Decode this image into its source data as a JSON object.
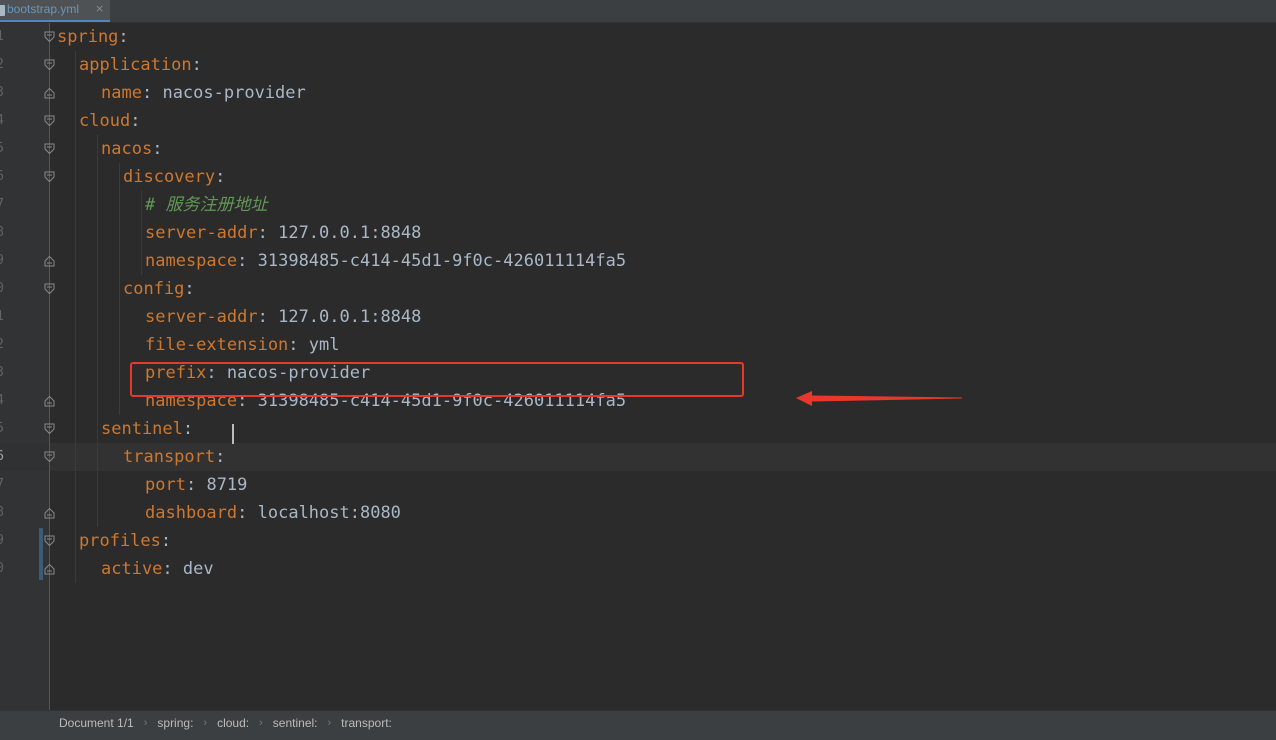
{
  "tab": {
    "filename": "bootstrap.yml",
    "close_glyph": "×",
    "icon": "yaml-file-icon"
  },
  "editor": {
    "lines": [
      {
        "num": "1",
        "indent": 0,
        "key": "spring",
        "value": "",
        "fold": "open"
      },
      {
        "num": "2",
        "indent": 1,
        "key": "application",
        "value": "",
        "fold": "open"
      },
      {
        "num": "3",
        "indent": 2,
        "key": "name",
        "value": "nacos-provider",
        "fold": "end"
      },
      {
        "num": "4",
        "indent": 1,
        "key": "cloud",
        "value": "",
        "fold": "open"
      },
      {
        "num": "5",
        "indent": 2,
        "key": "nacos",
        "value": "",
        "fold": "open"
      },
      {
        "num": "6",
        "indent": 3,
        "key": "discovery",
        "value": "",
        "fold": "open"
      },
      {
        "num": "7",
        "indent": 4,
        "comment": "# 服务注册地址"
      },
      {
        "num": "8",
        "indent": 4,
        "key": "server-addr",
        "value": "127.0.0.1:8848"
      },
      {
        "num": "9",
        "indent": 4,
        "key": "namespace",
        "value": "31398485-c414-45d1-9f0c-426011114fa5",
        "fold": "end"
      },
      {
        "num": "0",
        "indent": 3,
        "key": "config",
        "value": "",
        "fold": "open"
      },
      {
        "num": "1",
        "indent": 4,
        "key": "server-addr",
        "value": "127.0.0.1:8848"
      },
      {
        "num": "2",
        "indent": 4,
        "key": "file-extension",
        "value": "yml"
      },
      {
        "num": "3",
        "indent": 4,
        "key": "prefix",
        "value": "nacos-provider"
      },
      {
        "num": "4",
        "indent": 4,
        "key": "namespace",
        "value": "31398485-c414-45d1-9f0c-426011114fa5",
        "fold": "end"
      },
      {
        "num": "5",
        "indent": 2,
        "key": "sentinel",
        "value": "",
        "fold": "open"
      },
      {
        "num": "6",
        "indent": 3,
        "key": "transport",
        "value": "",
        "fold": "open",
        "current": true
      },
      {
        "num": "7",
        "indent": 4,
        "key": "port",
        "value": "8719"
      },
      {
        "num": "8",
        "indent": 4,
        "key": "dashboard",
        "value": "localhost:8080",
        "fold": "end"
      },
      {
        "num": "9",
        "indent": 1,
        "key": "profiles",
        "value": "",
        "fold": "open"
      },
      {
        "num": "0",
        "indent": 2,
        "key": "active",
        "value": "dev",
        "fold": "end"
      }
    ],
    "highlighted_line": 14,
    "caret_line": 16
  },
  "annotation": {
    "box_color": "#e8382c",
    "arrow_color": "#e8382c"
  },
  "statusbar": {
    "document": "Document 1/1",
    "breadcrumbs": [
      "spring:",
      "cloud:",
      "sentinel:",
      "transport:"
    ]
  },
  "colors": {
    "background": "#2b2b2b",
    "key": "#cc7832",
    "value": "#a9b7c6",
    "comment": "#629755",
    "line_number": "#606366"
  }
}
